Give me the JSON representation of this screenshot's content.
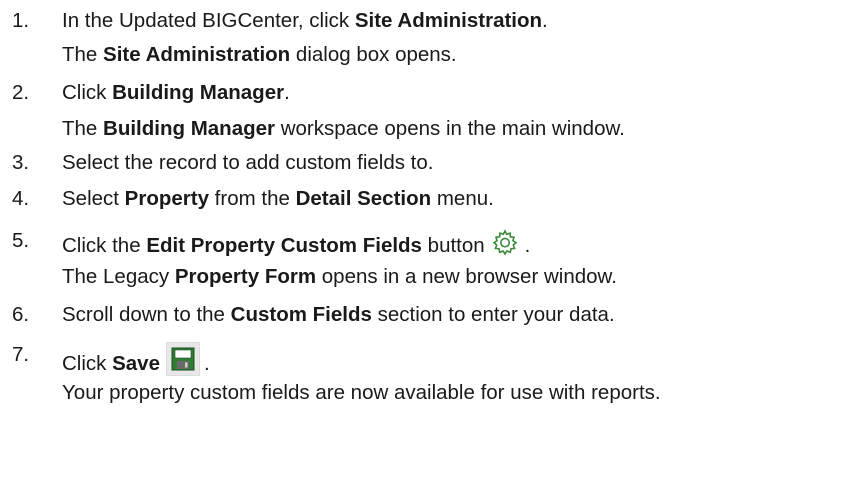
{
  "steps": [
    {
      "num": "1.",
      "pre": "In the Updated BIGCenter, click ",
      "bold": "Site Administration",
      "post": ".",
      "sub_pre": "The ",
      "sub_bold": "Site Administration",
      "sub_post": " dialog box opens."
    },
    {
      "num": "2.",
      "pre": "Click ",
      "bold": "Building Manager",
      "post": ".",
      "sub_pre": "The ",
      "sub_bold": "Building Manager",
      "sub_post": " workspace opens in the main window."
    },
    {
      "num": "3.",
      "text": "Select the record to add custom fields to."
    },
    {
      "num": "4.",
      "pre": "Select ",
      "bold": "Property",
      "mid": " from the ",
      "bold2": "Detail Section",
      "post": " menu."
    },
    {
      "num": "5.",
      "pre": "Click the ",
      "bold": "Edit Property Custom Fields",
      "mid": " button",
      "post": ".",
      "icon": "gear-icon",
      "sub_pre": "The Legacy ",
      "sub_bold": "Property Form",
      "sub_post": " opens in a new browser window."
    },
    {
      "num": "6.",
      "pre": "Scroll down to the ",
      "bold": "Custom Fields",
      "post": " section to enter your data."
    },
    {
      "num": "7.",
      "pre": "Click ",
      "bold": "Save",
      "post": ".",
      "icon": "save-icon",
      "sub_text": "Your property custom fields are now available for use with reports."
    }
  ],
  "colors": {
    "text": "#1a1a1a",
    "gear": "#3a8a3a",
    "save_green": "#2e7d32"
  }
}
